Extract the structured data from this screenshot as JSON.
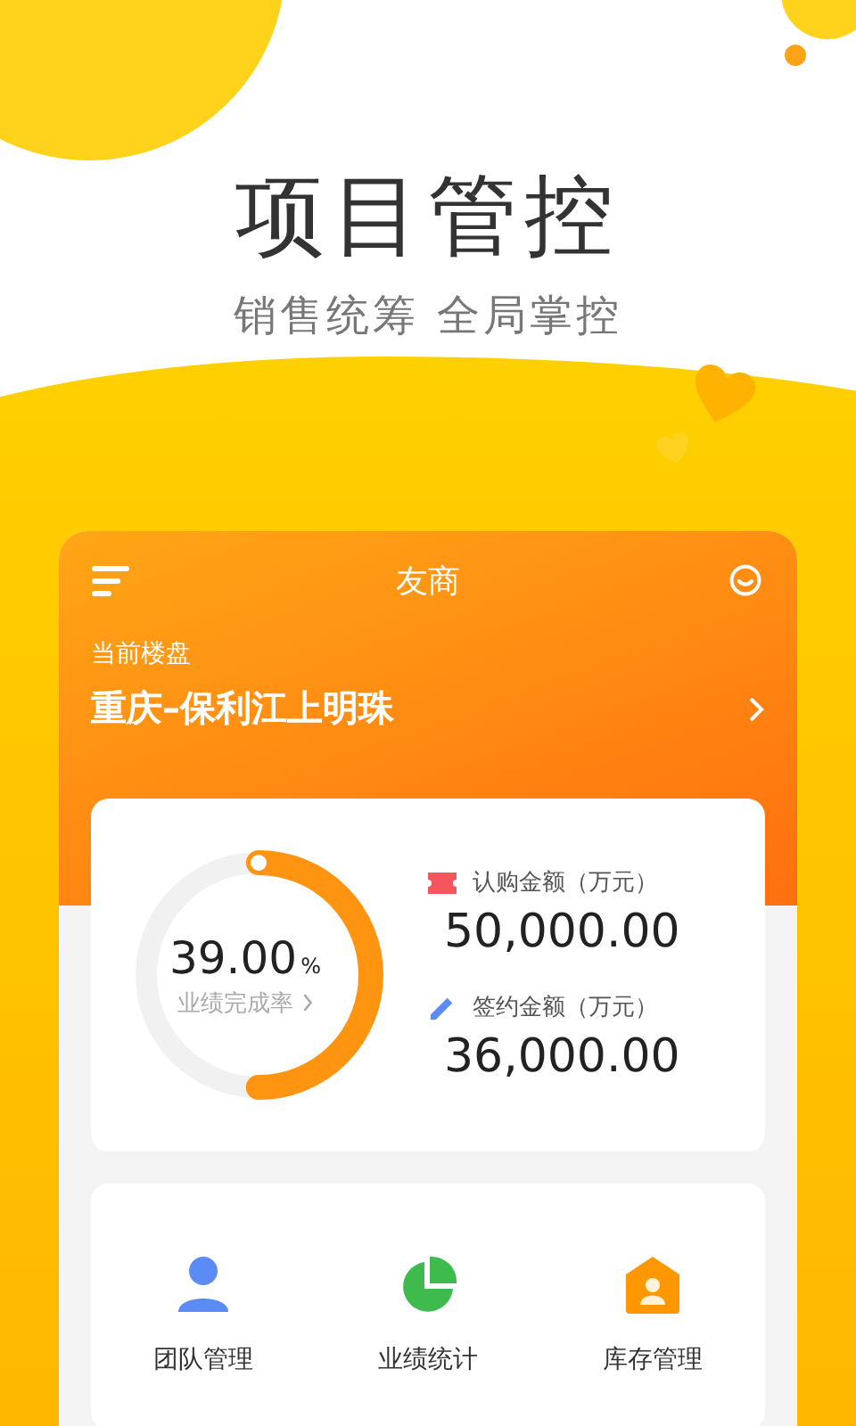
{
  "headline": {
    "title": "项目管控",
    "subtitle": "销售统筹 全局掌控"
  },
  "app": {
    "title": "友商",
    "project_label": "当前楼盘",
    "project_name": "重庆–保利江上明珠"
  },
  "progress": {
    "value": "39.00",
    "unit": "%",
    "label": "业绩完成率",
    "level": 0.5
  },
  "stats": [
    {
      "kind": "ticket",
      "label": "认购金额（万元）",
      "value": "50,000.00"
    },
    {
      "kind": "pen",
      "label": "签约金额（万元）",
      "value": "36,000.00"
    }
  ],
  "menu": [
    {
      "kind": "person",
      "label": "团队管理"
    },
    {
      "kind": "pie",
      "label": "业绩统计"
    },
    {
      "kind": "house",
      "label": "库存管理"
    }
  ]
}
